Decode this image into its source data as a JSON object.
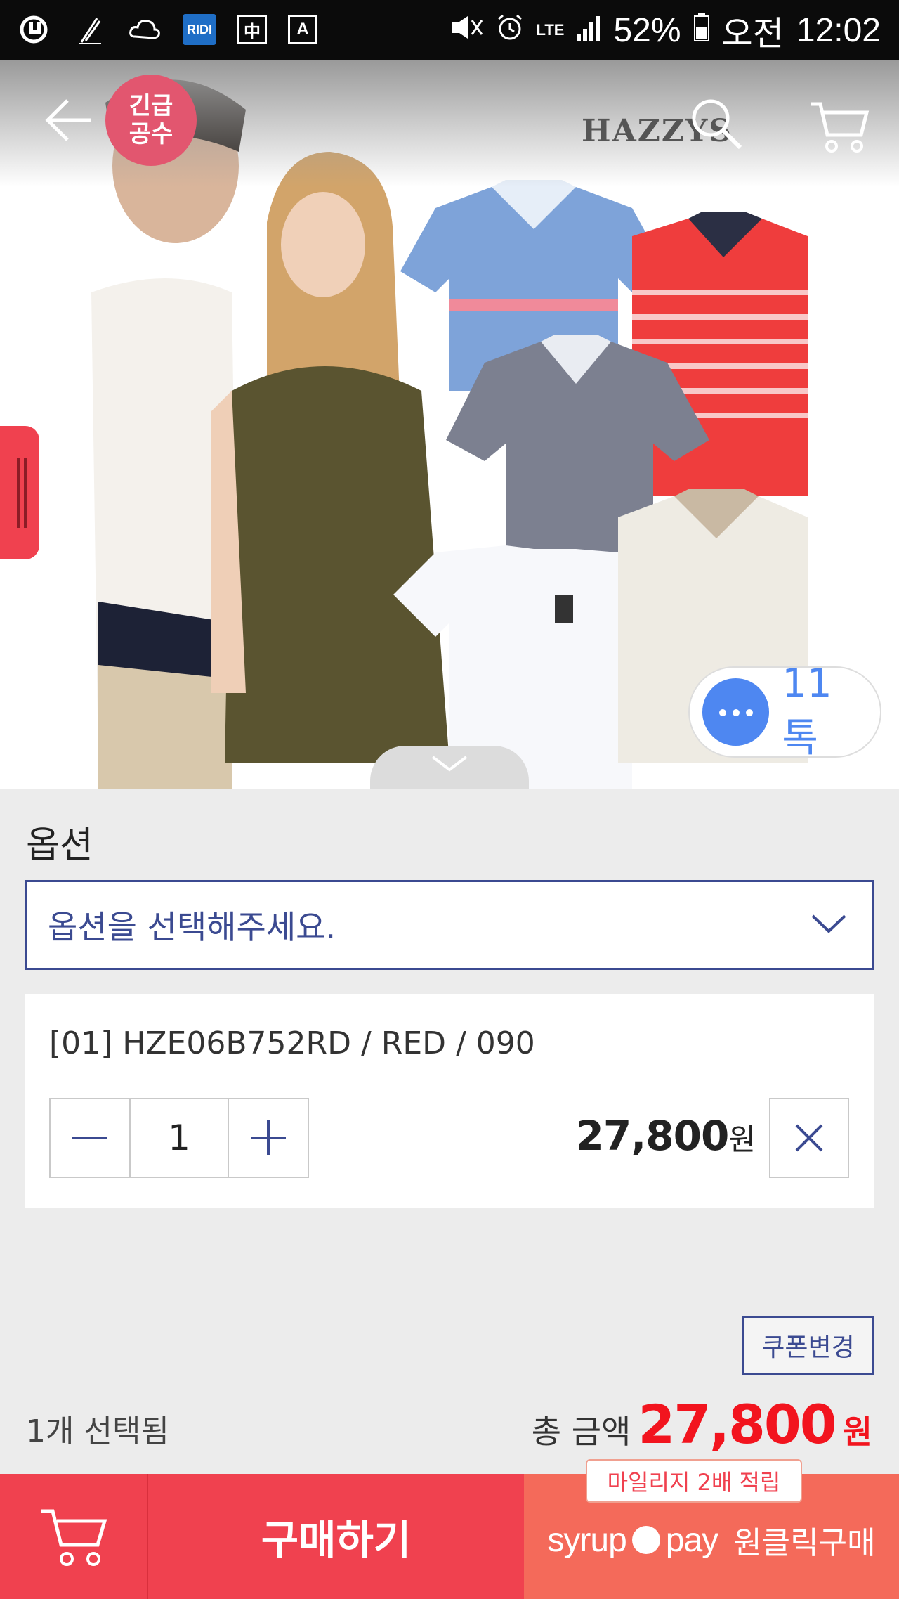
{
  "status_bar": {
    "left_icons": [
      "carrier-u-icon",
      "pen-icon",
      "weather-icon",
      "ridi-icon",
      "chinese-input-icon",
      "a-keyboard-icon"
    ],
    "ridi_label": "RIDI",
    "chinese_label": "中",
    "a_label": "A",
    "network": "LTE",
    "battery": "52%",
    "ampm": "오전",
    "time": "12:02"
  },
  "header": {
    "badge_line1": "긴급",
    "badge_line2": "공수",
    "brand": "HAZZYS"
  },
  "talk": {
    "label": "11 톡"
  },
  "options": {
    "title": "옵션",
    "select_placeholder": "옵션을 선택해주세요."
  },
  "item": {
    "name": "[01] HZE06B752RD / RED / 090",
    "quantity": "1",
    "price": "27,800",
    "price_unit": "원"
  },
  "summary": {
    "coupon_label": "쿠폰변경",
    "selected_count": "1개 선택됨",
    "total_label": "총 금액",
    "total_amount": "27,800",
    "total_unit": "원"
  },
  "bottom_bar": {
    "buy_label": "구매하기",
    "syrup_left": "syrup",
    "syrup_right": "pay",
    "one_click_label": "원클릭구매",
    "mileage_label": "마일리지 2배 적립"
  },
  "colors": {
    "accent_red": "#f0414f",
    "price_red": "#f2141e",
    "navy": "#3b4a91",
    "talk_blue": "#4e87f1",
    "syrup_coral": "#f46a5a"
  }
}
